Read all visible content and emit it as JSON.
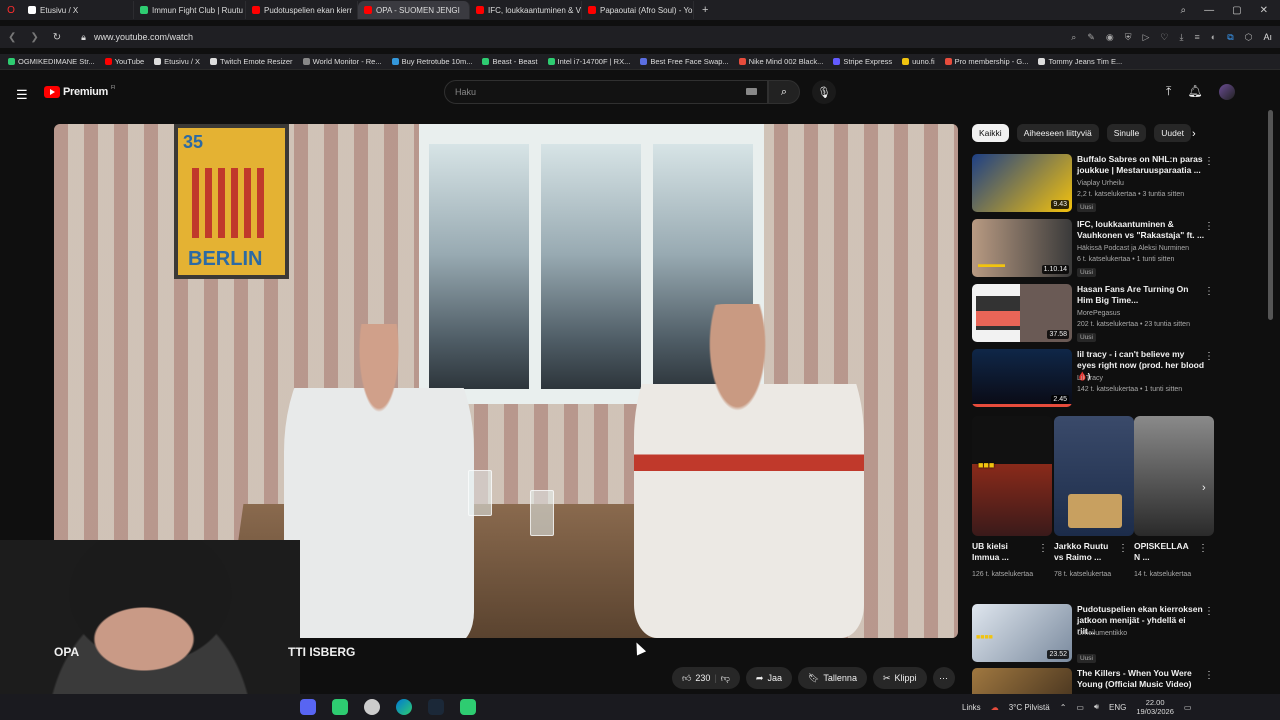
{
  "browser": {
    "tabs": [
      {
        "label": "Etusivu / X",
        "color": "#ffffff",
        "active": false
      },
      {
        "label": "Immun Fight Club | Ruutu",
        "color": "#2ecc71",
        "active": false
      },
      {
        "label": "Pudotuspelien ekan kierr",
        "color": "#ff0000",
        "active": false
      },
      {
        "label": "OPA - SUOMEN JENGI",
        "color": "#ff0000",
        "active": true
      },
      {
        "label": "IFC, loukkaantuminen & V",
        "color": "#ff0000",
        "active": false
      },
      {
        "label": "Papaoutai (Afro Soul) - Yo",
        "color": "#ff0000",
        "active": false
      }
    ],
    "url": "www.youtube.com/watch",
    "bookmarks": [
      {
        "label": "OGMIKEDIMANE Str...",
        "color": "#2ecc71"
      },
      {
        "label": "YouTube",
        "color": "#ff0000"
      },
      {
        "label": "Etusivu / X",
        "color": "#dddddd"
      },
      {
        "label": "Twitch Emote Resizer",
        "color": "#dddddd"
      },
      {
        "label": "World Monitor - Re...",
        "color": "#888888"
      },
      {
        "label": "Buy Retrotube 10m...",
        "color": "#3498db"
      },
      {
        "label": "Beast - Beast",
        "color": "#2ecc71"
      },
      {
        "label": "Intel i7-14700F | RX...",
        "color": "#2ecc71"
      },
      {
        "label": "Best Free Face Swap...",
        "color": "#5b6ee1"
      },
      {
        "label": "Nike Mind 002 Black...",
        "color": "#e74c3c"
      },
      {
        "label": "Stripe Express",
        "color": "#635bff"
      },
      {
        "label": "uuno.fi",
        "color": "#f1c40f"
      },
      {
        "label": "Pro membership - G...",
        "color": "#e74c3c"
      },
      {
        "label": "Tommy Jeans Tim E...",
        "color": "#dddddd"
      }
    ]
  },
  "youtube": {
    "logo_text": "Premium",
    "logo_sup": "FI",
    "search_placeholder": "Haku",
    "video": {
      "poster_number": "35",
      "poster_city": "BERLIN",
      "title_left": "OPA",
      "title_right": "TTI ISBERG",
      "likes": "230",
      "share_label": "Jaa",
      "save_label": "Tallenna",
      "clip_label": "Klippi"
    },
    "chips": [
      "Kaikki",
      "Aiheeseen liittyviä",
      "Sinulle",
      "Uudet"
    ],
    "recommendations": [
      {
        "title": "Buffalo Sabres on NHL:n paras joukkue | Mestaruusparaatia ...",
        "channel": "Viaplay Urheilu",
        "meta": "2,2 t. katselukertaa • 3 tuntia sitten",
        "badge": "Uusi",
        "duration": "9.43",
        "thumb": "#2b5ca8"
      },
      {
        "title": "IFC, loukkaantuminen & Vauhkonen vs \"Rakastaja\" ft. ...",
        "channel": "Häkissä Podcast ja Aleksi Nurminen",
        "meta": "6 t. katselukertaa • 1 tunti sitten",
        "badge": "Uusi",
        "duration": "1.10.14",
        "thumb": "#3a3a3a"
      },
      {
        "title": "Hasan Fans Are Turning On Him Big Time...",
        "channel": "MorePegasus",
        "meta": "202 t. katselukertaa • 23 tuntia sitten",
        "badge": "Uusi",
        "duration": "37.58",
        "thumb": "#c0392b"
      },
      {
        "title": "lil tracy - i can't believe my eyes right now (prod. her blood 🩸)",
        "channel": "Lil Tracy",
        "meta": "142 t. katselukertaa • 1 tunti sitten",
        "badge": "",
        "duration": "2.45",
        "thumb": "#1a3a6a"
      }
    ],
    "shorts": [
      {
        "title": "UB kielsi Immua ...",
        "views": "126 t. katselukertaa",
        "thumb": "#4a2a2a"
      },
      {
        "title": "Jarkko Ruutu vs Raimo ...",
        "views": "78 t. katselukertaa",
        "thumb": "#2a4a7a"
      },
      {
        "title": "OPISKELLAA N ...",
        "views": "14 t. katselukertaa",
        "thumb": "#555555"
      }
    ],
    "bottom_recs": [
      {
        "title": "Pudotuspelien ekan kierroksen jatkoon menijät - yhdellä ei riit...",
        "channel": "Urheilumentikko",
        "meta": "",
        "badge": "Uusi",
        "duration": "23.52",
        "thumb": "#8a9ab0"
      },
      {
        "title": "The Killers - When You Were Young (Official Music Video)",
        "channel": "",
        "meta": "",
        "badge": "",
        "duration": "",
        "thumb": "#7a5a2a"
      }
    ]
  },
  "taskbar": {
    "links_label": "Links",
    "weather": "3°C Pilvistä",
    "lang": "ENG",
    "time": "22.00",
    "date": "19/03/2026"
  }
}
